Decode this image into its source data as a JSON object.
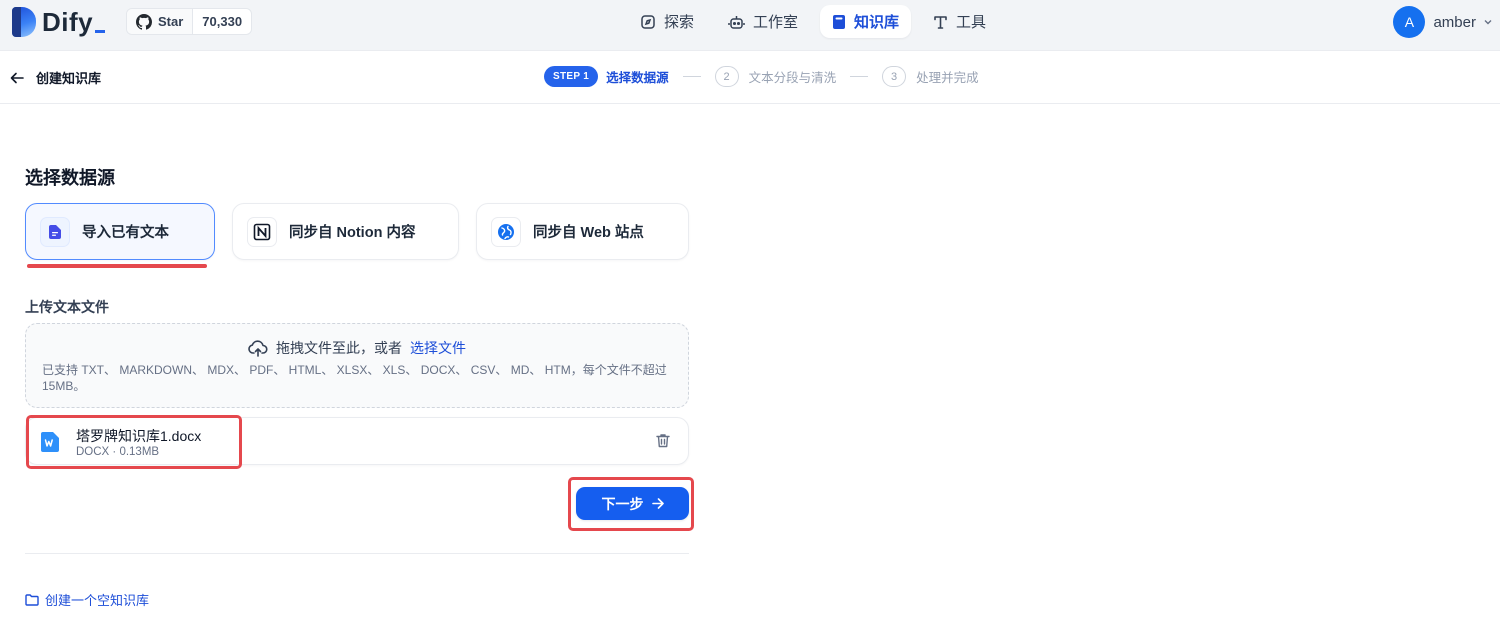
{
  "header": {
    "logo_text": "Dify",
    "github": {
      "star_label": "Star",
      "star_count": "70,330"
    },
    "nav": [
      {
        "label": "探索",
        "icon": "explore-icon",
        "active": false
      },
      {
        "label": "工作室",
        "icon": "robot-icon",
        "active": false
      },
      {
        "label": "知识库",
        "icon": "book-icon",
        "active": true
      },
      {
        "label": "工具",
        "icon": "tool-icon",
        "active": false
      }
    ],
    "user": {
      "avatar_letter": "A",
      "name": "amber"
    }
  },
  "subheader": {
    "back_label": "创建知识库",
    "steps": [
      {
        "badge": "STEP 1",
        "label": "选择数据源",
        "active": true
      },
      {
        "number": "2",
        "label": "文本分段与清洗",
        "active": false
      },
      {
        "number": "3",
        "label": "处理并完成",
        "active": false
      }
    ]
  },
  "main": {
    "title": "选择数据源",
    "sources": [
      {
        "label": "导入已有文本",
        "icon": "file-text-icon",
        "active": true
      },
      {
        "label": "同步自 Notion 内容",
        "icon": "notion-icon",
        "active": false
      },
      {
        "label": "同步自 Web 站点",
        "icon": "web-globe-icon",
        "active": false
      }
    ],
    "upload_label": "上传文本文件",
    "dropzone": {
      "prompt": "拖拽文件至此，或者",
      "select_link": "选择文件",
      "hint": "已支持 TXT、 MARKDOWN、 MDX、 PDF、 HTML、 XLSX、 XLS、 DOCX、 CSV、 MD、 HTM，每个文件不超过 15MB。"
    },
    "file": {
      "name": "塔罗牌知识库1.docx",
      "meta": "DOCX · 0.13MB"
    },
    "next_label": "下一步",
    "empty_kb_link": "创建一个空知识库"
  },
  "colors": {
    "accent": "#155eef",
    "highlight_red": "#e5484d"
  }
}
